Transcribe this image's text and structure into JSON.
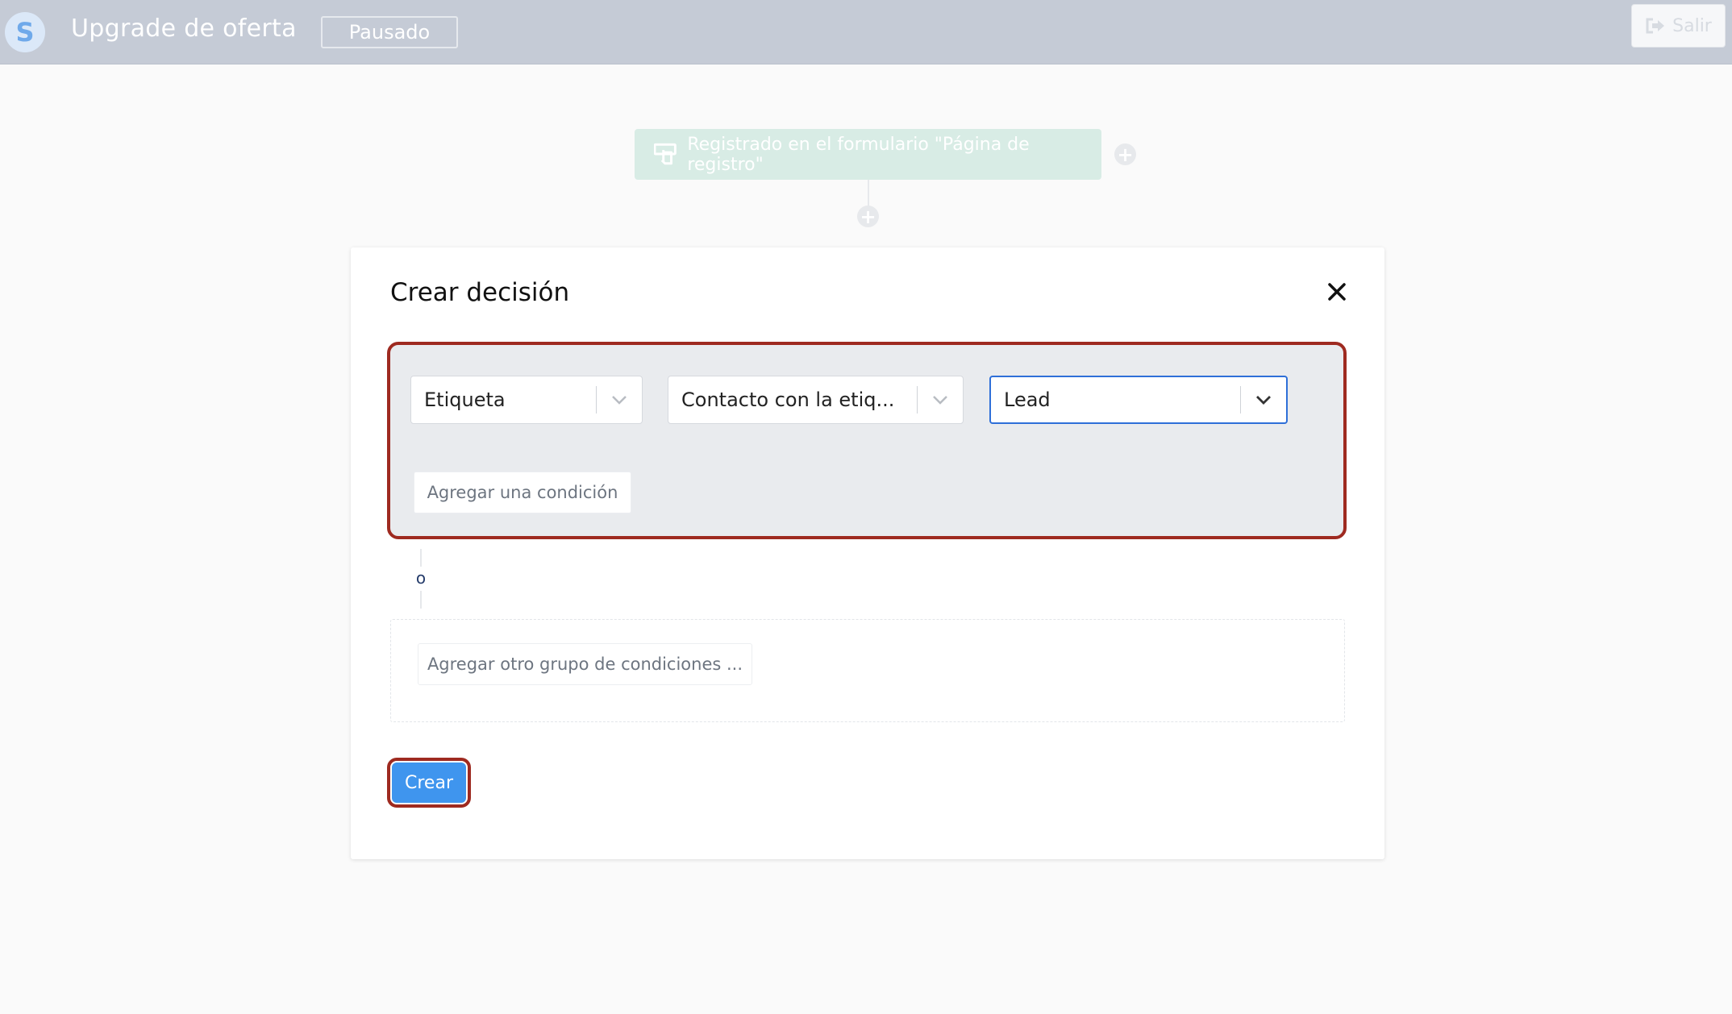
{
  "header": {
    "logo_letter": "S",
    "title": "Upgrade de oferta",
    "status": "Pausado",
    "exit_label": "Salir"
  },
  "flow": {
    "trigger_label": "Registrado en el formulario \"Página de registro\""
  },
  "modal": {
    "title": "Crear decisión",
    "condition_group": {
      "selects": [
        {
          "value": "Etiqueta"
        },
        {
          "value": "Contacto con la etiq..."
        },
        {
          "value": "Lead"
        }
      ],
      "add_condition_label": "Agregar una condición"
    },
    "or_label": "o",
    "add_group_label": "Agregar otro grupo de condiciones ...",
    "create_label": "Crear"
  },
  "icons": {
    "logo": "logo-icon",
    "exit": "exit-icon",
    "trigger": "form-hand-icon",
    "add": "plus-circle-icon",
    "close": "close-icon",
    "dropdown": "chevron-down-icon"
  },
  "colors": {
    "header_bg": "#c5cbd6",
    "primary": "#3f95ee",
    "highlight": "#9e2a20",
    "trigger_bg": "#d8ece5"
  }
}
